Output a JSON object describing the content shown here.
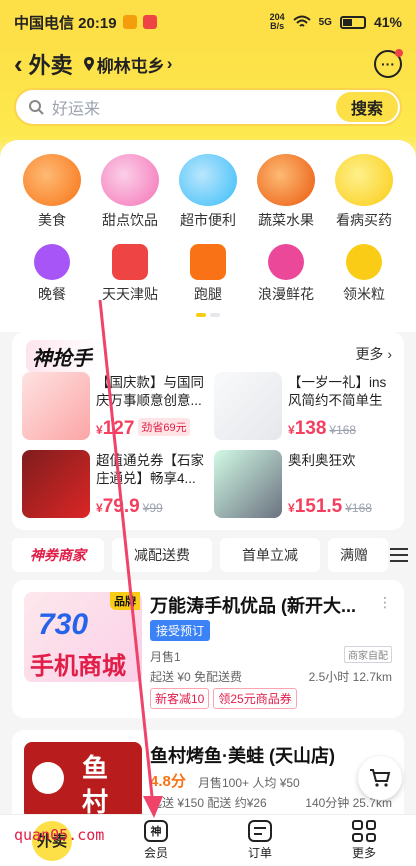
{
  "status_bar": {
    "carrier_time": "中国电信 20:19",
    "netspeed_value": "204",
    "netspeed_unit": "B/s",
    "signal": "5G",
    "battery": "41%"
  },
  "nav": {
    "title": "外卖",
    "location": "柳林屯乡"
  },
  "search": {
    "placeholder": "好运来",
    "button": "搜索"
  },
  "categories_row1": [
    {
      "label": "美食",
      "color": "#f97316"
    },
    {
      "label": "甜点饮品",
      "color": "#f472b6"
    },
    {
      "label": "超市便利",
      "color": "#38bdf8"
    },
    {
      "label": "蔬菜水果",
      "color": "#22c55e"
    },
    {
      "label": "看病买药",
      "color": "#facc15"
    }
  ],
  "categories_row2": [
    {
      "label": "晚餐",
      "color": "#a855f7"
    },
    {
      "label": "天天津贴",
      "color": "#ef4444"
    },
    {
      "label": "跑腿",
      "color": "#f97316"
    },
    {
      "label": "浪漫鲜花",
      "color": "#ec4899"
    },
    {
      "label": "领米粒",
      "color": "#facc15"
    }
  ],
  "grab": {
    "title": "神抢手",
    "more": "更多",
    "products": [
      {
        "name": "【国庆款】与国同庆万事顺意创意...",
        "currency": "¥",
        "price": "127",
        "tag": "劲省69元",
        "orig": ""
      },
      {
        "name": "【一岁一礼】ins风简约不简单生日...",
        "currency": "¥",
        "price": "138",
        "tag": "",
        "orig": "¥168"
      },
      {
        "name": "超值通兑券【石家庄通兑】畅享4...",
        "currency": "¥",
        "price": "79.9",
        "tag": "",
        "orig": "¥99"
      },
      {
        "name": "奥利奥狂欢",
        "currency": "¥",
        "price": "151.5",
        "tag": "",
        "orig": "¥168"
      }
    ]
  },
  "filters": [
    "神券商家",
    "减配送费",
    "首单立减",
    "满赠"
  ],
  "shop1": {
    "badge": "品牌",
    "name": "万能涛手机优品 (新开大...",
    "chip": "接受预订",
    "sales": "月售1",
    "self_delivery": "商家自配",
    "delivery": "起送 ¥0  免配送费",
    "distance": "2.5小时  12.7km",
    "coupons": [
      "新客减10",
      "领25元商品券"
    ],
    "thumb_text1": "730",
    "thumb_text2": "手机商城"
  },
  "shop2": {
    "name": "鱼村烤鱼·美蛙 (天山店)",
    "score": "4.8分",
    "sales": "月售100+  人均 ¥50",
    "delivery": "起送 ¥150  配送 约¥26",
    "distance": "140分钟  25.7km",
    "thumb_text1": "鱼",
    "thumb_text2": "村"
  },
  "tabbar": {
    "home": "外卖",
    "member": "会员",
    "member_icon": "神",
    "order": "订单",
    "more": "更多"
  },
  "watermark": "quan05.com",
  "colors": {
    "brand_yellow": "#fde047",
    "price_red": "#f43f5e",
    "annotation_arrow": "#f0436a"
  }
}
